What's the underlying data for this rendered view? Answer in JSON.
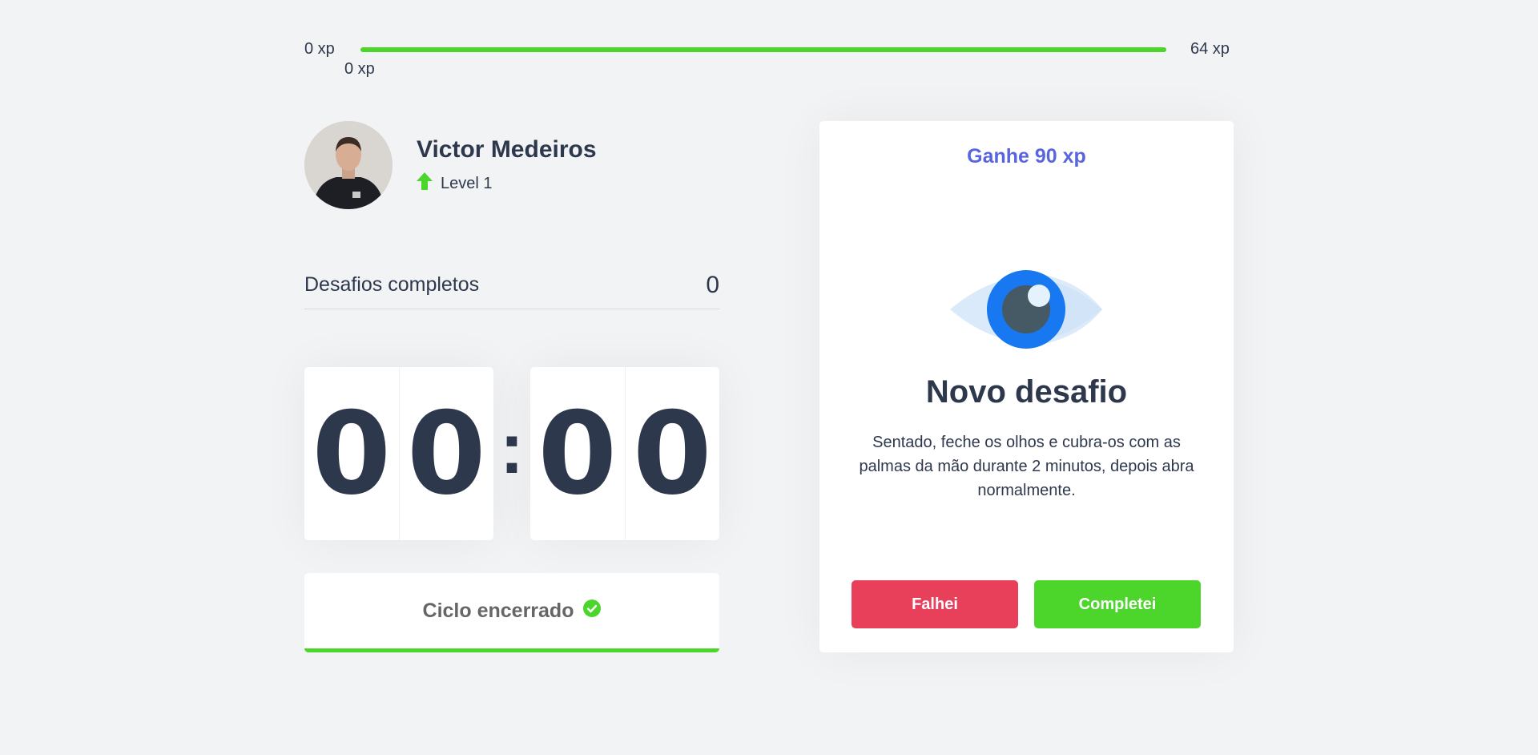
{
  "experience": {
    "min_label": "0 xp",
    "max_label": "64 xp",
    "current_label": "0 xp",
    "progress_fraction": 1.0
  },
  "profile": {
    "name": "Victor Medeiros",
    "level_label": "Level 1",
    "level_icon": "level-up-arrow-icon"
  },
  "completed_challenges": {
    "label": "Desafios completos",
    "count": "0"
  },
  "countdown": {
    "minutes_left": "0",
    "minutes_right": "0",
    "separator": ":",
    "seconds_left": "0",
    "seconds_right": "0"
  },
  "cycle_button": {
    "label": "Ciclo encerrado",
    "icon": "check-circle-icon"
  },
  "challenge": {
    "reward": "Ganhe 90 xp",
    "icon": "eye-icon",
    "title": "Novo desafio",
    "description": "Sentado, feche os olhos e cubra-os com as palmas da mão durante 2 minutos, depois abra normalmente.",
    "fail_label": "Falhei",
    "complete_label": "Completei"
  },
  "colors": {
    "green": "#4cd62b",
    "red": "#e83f5b",
    "blue": "#5965e0",
    "title": "#2e384d",
    "background": "#f2f3f5"
  }
}
